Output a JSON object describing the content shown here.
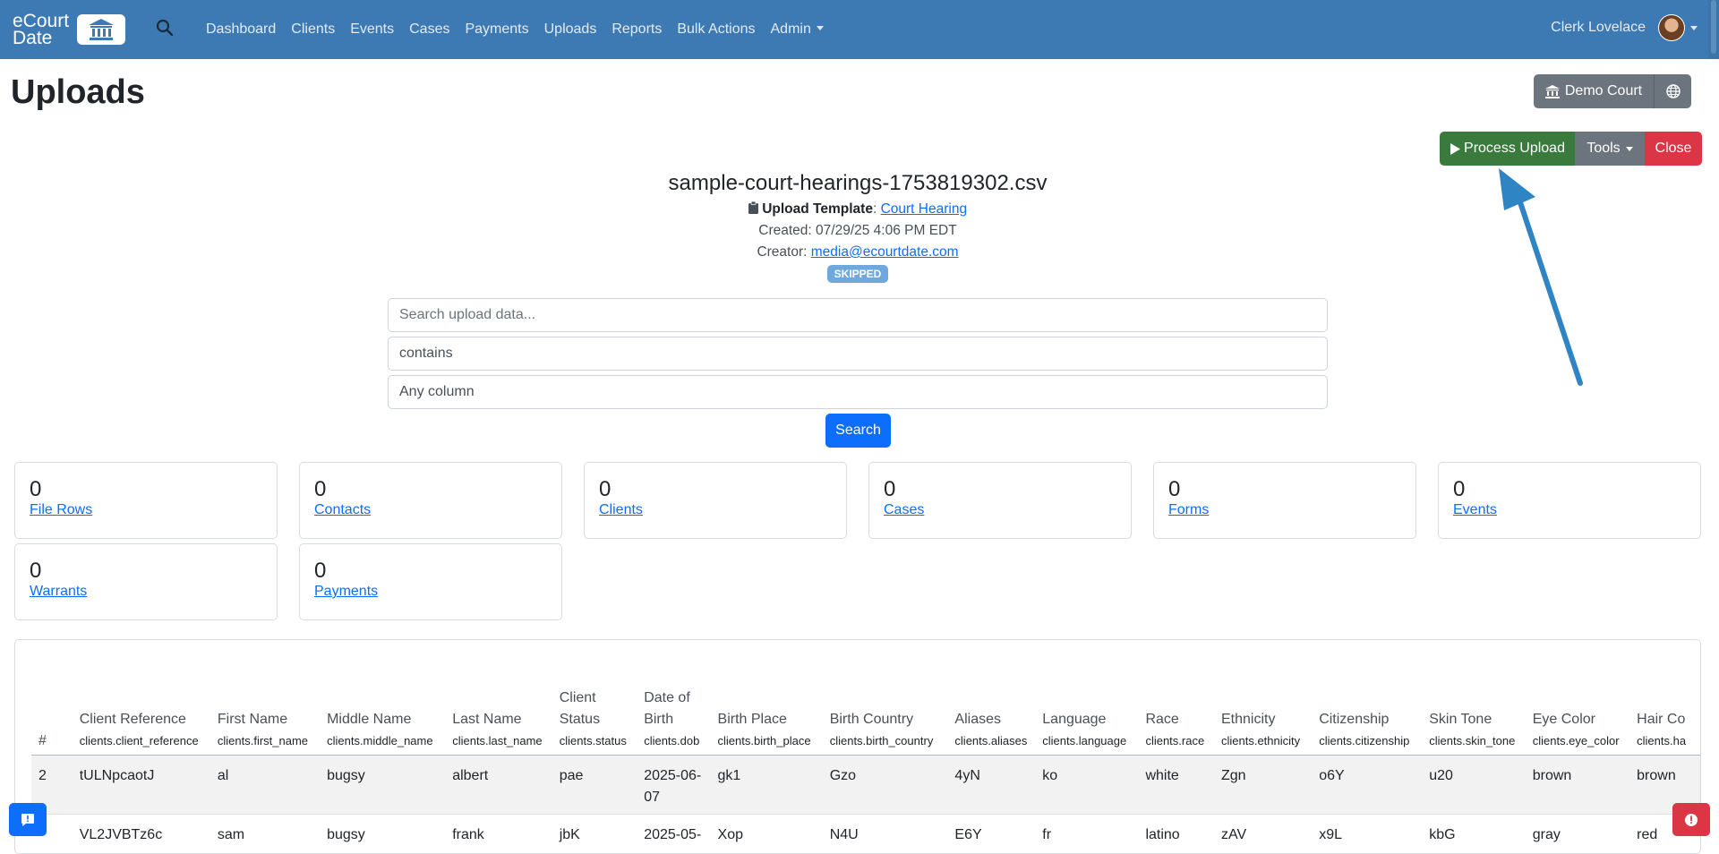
{
  "nav": {
    "brand_line1": "eCourt",
    "brand_line2": "Date",
    "links": [
      "Dashboard",
      "Clients",
      "Events",
      "Cases",
      "Payments",
      "Uploads",
      "Reports",
      "Bulk Actions",
      "Admin"
    ],
    "user_name": "Clerk Lovelace"
  },
  "page": {
    "title": "Uploads",
    "court_button": "Demo Court",
    "process_upload": "Process Upload",
    "tools": "Tools",
    "close": "Close"
  },
  "file": {
    "name": "sample-court-hearings-1753819302.csv",
    "template_label": "Upload Template",
    "template_value": "Court Hearing",
    "created": "Created: 07/29/25 4:06 PM EDT",
    "creator_label": "Creator: ",
    "creator_value": "media@ecourtdate.com",
    "status": "SKIPPED"
  },
  "search": {
    "placeholder": "Search upload data...",
    "operator": "contains",
    "column": "Any column",
    "button": "Search"
  },
  "stats": [
    {
      "value": "0",
      "label": "File Rows"
    },
    {
      "value": "0",
      "label": "Contacts"
    },
    {
      "value": "0",
      "label": "Clients"
    },
    {
      "value": "0",
      "label": "Cases"
    },
    {
      "value": "0",
      "label": "Forms"
    },
    {
      "value": "0",
      "label": "Events"
    },
    {
      "value": "0",
      "label": "Warrants"
    },
    {
      "value": "0",
      "label": "Payments"
    }
  ],
  "table": {
    "columns": [
      {
        "label": "#",
        "key": ""
      },
      {
        "label": "Client Reference",
        "key": "clients.client_reference"
      },
      {
        "label": "First Name",
        "key": "clients.first_name"
      },
      {
        "label": "Middle Name",
        "key": "clients.middle_name"
      },
      {
        "label": "Last Name",
        "key": "clients.last_name"
      },
      {
        "label": "Client Status",
        "key": "clients.status"
      },
      {
        "label": "Date of Birth",
        "key": "clients.dob"
      },
      {
        "label": "Birth Place",
        "key": "clients.birth_place"
      },
      {
        "label": "Birth Country",
        "key": "clients.birth_country"
      },
      {
        "label": "Aliases",
        "key": "clients.aliases"
      },
      {
        "label": "Language",
        "key": "clients.language"
      },
      {
        "label": "Race",
        "key": "clients.race"
      },
      {
        "label": "Ethnicity",
        "key": "clients.ethnicity"
      },
      {
        "label": "Citizenship",
        "key": "clients.citizenship"
      },
      {
        "label": "Skin Tone",
        "key": "clients.skin_tone"
      },
      {
        "label": "Eye Color",
        "key": "clients.eye_color"
      },
      {
        "label": "Hair Co",
        "key": "clients.ha"
      }
    ],
    "rows": [
      [
        "2",
        "tULNpcaotJ",
        "al",
        "bugsy",
        "albert",
        "pae",
        "2025-06-07",
        "gk1",
        "Gzo",
        "4yN",
        "ko",
        "white",
        "Zgn",
        "o6Y",
        "u20",
        "brown",
        "brown"
      ],
      [
        "",
        "VL2JVBTz6c",
        "sam",
        "bugsy",
        "frank",
        "jbK",
        "2025-05-",
        "Xop",
        "N4U",
        "E6Y",
        "fr",
        "latino",
        "zAV",
        "x9L",
        "kbG",
        "gray",
        "red"
      ]
    ]
  }
}
